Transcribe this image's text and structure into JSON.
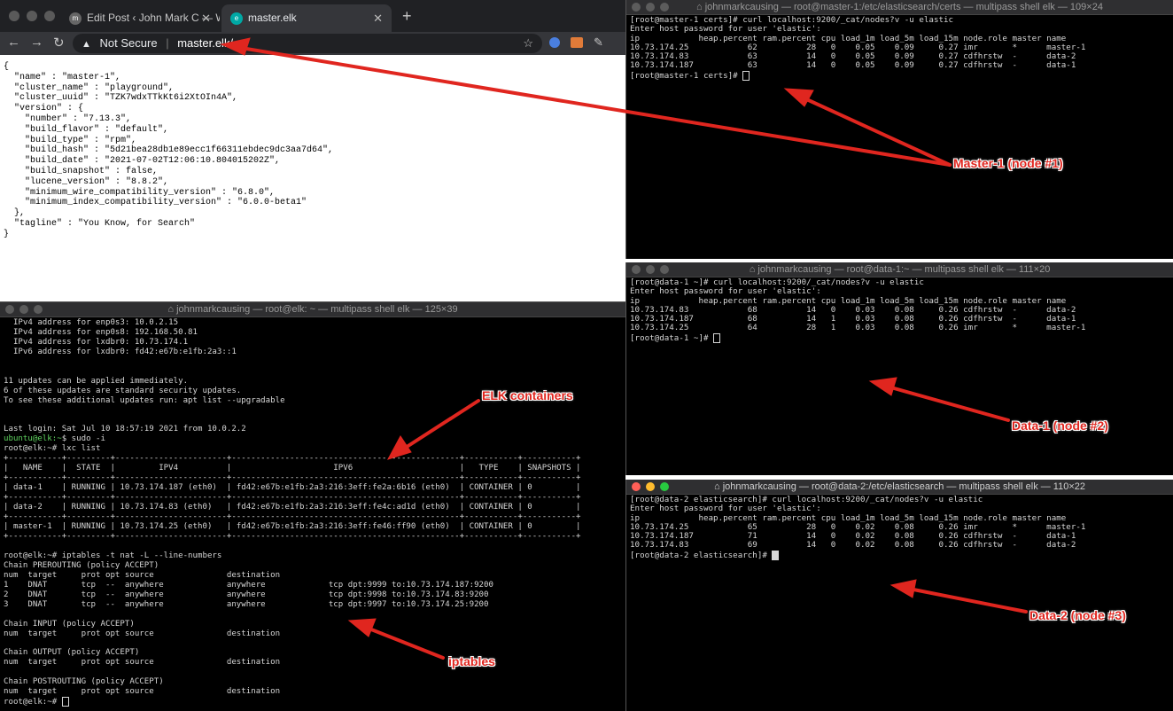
{
  "browser": {
    "tabs": [
      {
        "label": "Edit Post ‹ John Mark C — Wo",
        "favicon": "wordpress-icon"
      },
      {
        "label": "master.elk",
        "favicon": "elastic-icon"
      }
    ],
    "new_tab": "+",
    "security_label": "Not Secure",
    "url": "master.elk/",
    "response": "{\n  \"name\" : \"master-1\",\n  \"cluster_name\" : \"playground\",\n  \"cluster_uuid\" : \"TZK7wdxTTkKt6i2XtOIn4A\",\n  \"version\" : {\n    \"number\" : \"7.13.3\",\n    \"build_flavor\" : \"default\",\n    \"build_type\" : \"rpm\",\n    \"build_hash\" : \"5d21bea28db1e89ecc1f66311ebdec9dc3aa7d64\",\n    \"build_date\" : \"2021-07-02T12:06:10.804015202Z\",\n    \"build_snapshot\" : false,\n    \"lucene_version\" : \"8.8.2\",\n    \"minimum_wire_compatibility_version\" : \"6.8.0\",\n    \"minimum_index_compatibility_version\" : \"6.0.0-beta1\"\n  },\n  \"tagline\" : \"You Know, for Search\"\n}"
  },
  "terminals": {
    "master1": {
      "title": "johnmarkcausing — root@master-1:/etc/elasticsearch/certs — multipass shell elk — 109×24",
      "text": "[root@master-1 certs]# curl localhost:9200/_cat/nodes?v -u elastic\nEnter host password for user 'elastic':\nip            heap.percent ram.percent cpu load_1m load_5m load_15m node.role master name\n10.73.174.25            62          28   0    0.05    0.09     0.27 imr       *      master-1\n10.73.174.83            63          14   0    0.05    0.09     0.27 cdfhrstw  -      data-2\n10.73.174.187           63          14   0    0.05    0.09     0.27 cdfhrstw  -      data-1",
      "prompt": "[root@master-1 certs]# "
    },
    "data1": {
      "title": "johnmarkcausing — root@data-1:~ — multipass shell elk — 111×20",
      "text": "[root@data-1 ~]# curl localhost:9200/_cat/nodes?v -u elastic\nEnter host password for user 'elastic':\nip            heap.percent ram.percent cpu load_1m load_5m load_15m node.role master name\n10.73.174.83            68          14   0    0.03    0.08     0.26 cdfhrstw  -      data-2\n10.73.174.187           68          14   1    0.03    0.08     0.26 cdfhrstw  -      data-1\n10.73.174.25            64          28   1    0.03    0.08     0.26 imr       *      master-1",
      "prompt": "[root@data-1 ~]# "
    },
    "data2": {
      "title": "johnmarkcausing — root@data-2:/etc/elasticsearch — multipass shell elk — 110×22",
      "text": "[root@data-2 elasticsearch]# curl localhost:9200/_cat/nodes?v -u elastic\nEnter host password for user 'elastic':\nip            heap.percent ram.percent cpu load_1m load_5m load_15m node.role master name\n10.73.174.25            65          28   0    0.02    0.08     0.26 imr       *      master-1\n10.73.174.187           71          14   0    0.02    0.08     0.26 cdfhrstw  -      data-1\n10.73.174.83            69          14   0    0.02    0.08     0.26 cdfhrstw  -      data-2",
      "prompt": "[root@data-2 elasticsearch]# "
    },
    "elk": {
      "title": "johnmarkcausing — root@elk: ~ — multipass shell elk — 125×39",
      "text_a": "  IPv4 address for enp0s3: 10.0.2.15\n  IPv4 address for enp0s8: 192.168.50.81\n  IPv4 address for lxdbr0: 10.73.174.1\n  IPv6 address for lxdbr0: fd42:e67b:e1fb:2a3::1\n\n\n11 updates can be applied immediately.\n6 of these updates are standard security updates.\nTo see these additional updates run: apt list --upgradable\n\n\nLast login: Sat Jul 10 18:57:19 2021 from 10.0.2.2",
      "ubuntu_prompt": "ubuntu@elk:~",
      "ubuntu_cmd": "$ sudo -i",
      "text_b": "root@elk:~# lxc list\n+-----------+---------+-----------------------+-----------------------------------------------+-----------+-----------+\n|   NAME    |  STATE  |         IPV4          |                     IPV6                      |   TYPE    | SNAPSHOTS |\n+-----------+---------+-----------------------+-----------------------------------------------+-----------+-----------+\n| data-1    | RUNNING | 10.73.174.187 (eth0)  | fd42:e67b:e1fb:2a3:216:3eff:fe2a:6b16 (eth0)  | CONTAINER | 0         |\n+-----------+---------+-----------------------+-----------------------------------------------+-----------+-----------+\n| data-2    | RUNNING | 10.73.174.83 (eth0)   | fd42:e67b:e1fb:2a3:216:3eff:fe4c:ad1d (eth0)  | CONTAINER | 0         |\n+-----------+---------+-----------------------+-----------------------------------------------+-----------+-----------+\n| master-1  | RUNNING | 10.73.174.25 (eth0)   | fd42:e67b:e1fb:2a3:216:3eff:fe46:ff90 (eth0)  | CONTAINER | 0         |\n+-----------+---------+-----------------------+-----------------------------------------------+-----------+-----------+\n\nroot@elk:~# iptables -t nat -L --line-numbers\nChain PREROUTING (policy ACCEPT)\nnum  target     prot opt source               destination\n1    DNAT       tcp  --  anywhere             anywhere             tcp dpt:9999 to:10.73.174.187:9200\n2    DNAT       tcp  --  anywhere             anywhere             tcp dpt:9998 to:10.73.174.83:9200\n3    DNAT       tcp  --  anywhere             anywhere             tcp dpt:9997 to:10.73.174.25:9200\n\nChain INPUT (policy ACCEPT)\nnum  target     prot opt source               destination\n\nChain OUTPUT (policy ACCEPT)\nnum  target     prot opt source               destination\n\nChain POSTROUTING (policy ACCEPT)\nnum  target     prot opt source               destination",
      "prompt": "root@elk:~# "
    }
  },
  "annotations": {
    "master1": "Master-1 (node #1)",
    "data1": "Data-1 (node #2)",
    "data2": "Data-2 (node #3)",
    "elk": "ELK containers",
    "iptables": "iptables"
  },
  "colors": {
    "arrow": "#e0261f",
    "terminal_bg": "#000000",
    "prompt_green": "#5fd25f"
  }
}
